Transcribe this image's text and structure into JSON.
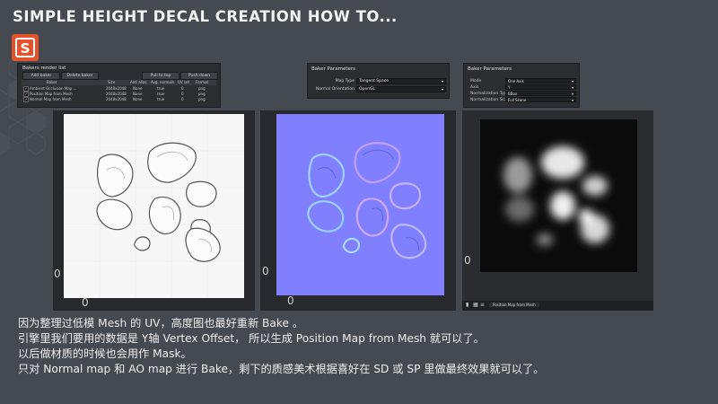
{
  "title": "SIMPLE  HEIGHT  DECAL  CREATION  HOW  TO...",
  "logo": {
    "icon": "substance-designer-logo",
    "letter": "S",
    "color": "#e5532d"
  },
  "bakers_panel": {
    "title": "Bakers render list",
    "add_label": "Add baker",
    "delete_label": "Delete baker",
    "pull_label": "Pull to top",
    "push_label": "Push down",
    "columns": [
      "Baker",
      "Size",
      "Anti alias.",
      "Avg. normals",
      "UV set",
      "Format"
    ],
    "rows": [
      {
        "checked": "✓",
        "name": "Ambient Occlusion Map ...",
        "size": "2048x2048",
        "aa": "None",
        "avg": "true",
        "uv": "0",
        "format": "png"
      },
      {
        "checked": "✓",
        "name": "Position Map from Mesh",
        "size": "2048x2048",
        "aa": "None",
        "avg": "true",
        "uv": "0",
        "format": "png"
      },
      {
        "checked": "✓",
        "name": "Normal Map from Mesh",
        "size": "2048x2048",
        "aa": "None",
        "avg": "true",
        "uv": "0",
        "format": "png"
      }
    ]
  },
  "normal_params": {
    "title": "Baker Parameters",
    "map_type_label": "Map Type",
    "map_type_value": "Tangent Space",
    "orientation_label": "Normal Orientation",
    "orientation_value": "OpenGL"
  },
  "position_params": {
    "title": "Baker Parameters",
    "mode_label": "Mode",
    "mode_value": "One Axis",
    "axis_label": "Axis",
    "axis_value": "Y",
    "norm_type_label": "Normalization Type",
    "norm_type_value": "BBox",
    "norm_scale_label": "Normalization Scale",
    "norm_scale_value": "Full Scene"
  },
  "viewer_ao": {
    "zero_a": "0",
    "zero_b": "0",
    "background": "#f7f7f7"
  },
  "viewer_normal": {
    "zero_a": "0",
    "zero_b": "0",
    "background": "#8080ff"
  },
  "viewer_position": {
    "zero_a": "0",
    "status": "Position Map from Mesh",
    "background": "#0b0b0b"
  },
  "caption": {
    "line1": "因为整理过低模 Mesh 的 UV，高度图也最好重新 Bake 。",
    "line2": "引擎里我们要用的数据是 Y轴 Vertex Offset， 所以生成 Position Map from Mesh 就可以了。",
    "line3": "以后做材质的时候也会用作 Mask。",
    "line4": "只对 Normal map 和 AO map 进行 Bake，剩下的质感美术根据喜好在 SD 或 SP 里做最终效果就可以了。"
  }
}
